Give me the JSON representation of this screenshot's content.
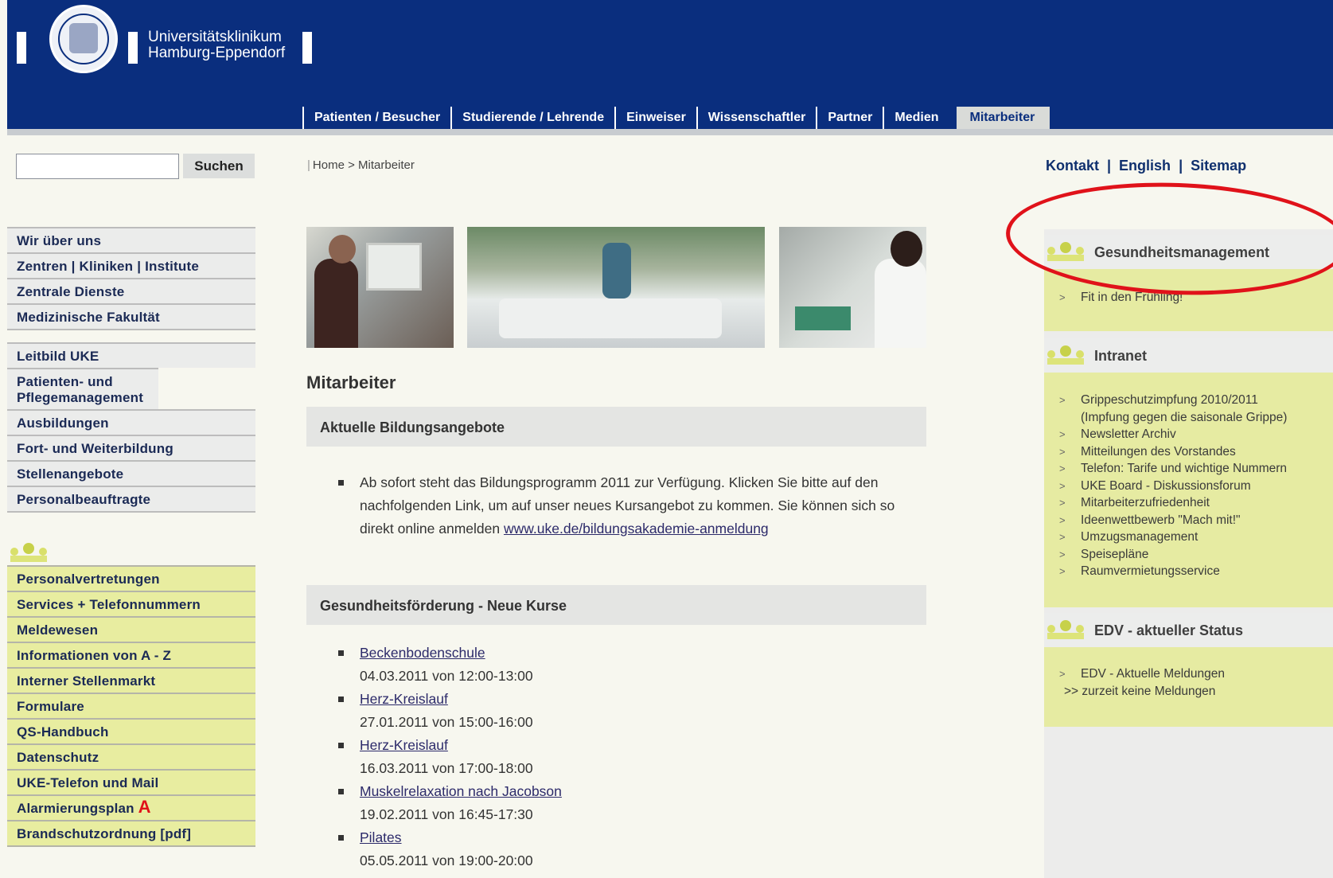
{
  "brand": {
    "line1": "Universitätsklinikum",
    "line2": "Hamburg-Eppendorf"
  },
  "topnav": [
    "Patienten / Besucher",
    "Studierende / Lehrende",
    "Einweiser",
    "Wissenschaftler",
    "Partner",
    "Medien",
    "Mitarbeiter"
  ],
  "search": {
    "placeholder": "",
    "button": "Suchen"
  },
  "breadcrumb": {
    "home": "Home",
    "sep": ">",
    "current": "Mitarbeiter",
    "bar": "|"
  },
  "util": {
    "kontakt": "Kontakt",
    "english": "English",
    "sitemap": "Sitemap",
    "bar": "|"
  },
  "leftnav": {
    "group1": [
      "Wir über uns",
      "Zentren |  Kliniken |  Institute",
      "Zentrale Dienste",
      "Medizinische Fakultät"
    ],
    "group2": [
      "Leitbild UKE",
      "Patienten- und Pflegemanagement",
      "Ausbildungen",
      "Fort- und Weiterbildung",
      "Stellenangebote",
      "Personalbeauftragte"
    ],
    "group3": [
      "Personalvertretungen",
      "Services + Telefonnummern",
      "Meldewesen",
      "Informationen von A - Z",
      "Interner Stellenmarkt",
      "Formulare",
      "QS-Handbuch",
      "Datenschutz",
      "UKE-Telefon und Mail",
      "Alarmierungsplan",
      "Brandschutzordnung [pdf]"
    ],
    "alarm_icon": "A"
  },
  "main": {
    "title": "Mitarbeiter",
    "section1": "Aktuelle Bildungsangebote",
    "bullet1_text": "Ab sofort steht das Bildungsprogramm 2011 zur Verfügung. Klicken Sie bitte auf den nachfolgenden Link, um auf unser neues Kursangebot zu kommen. Sie können sich so direkt online anmelden ",
    "bullet1_link": "www.uke.de/bildungsakademie-anmeldung",
    "section2": "Gesundheitsförderung - Neue Kurse",
    "courses": [
      {
        "name": "Beckenbodenschule",
        "date": "04.03.2011 von 12:00-13:00"
      },
      {
        "name": "Herz-Kreislauf",
        "date": "27.01.2011 von 15:00-16:00"
      },
      {
        "name": "Herz-Kreislauf",
        "date": "16.03.2011 von 17:00-18:00"
      },
      {
        "name": "Muskelrelaxation nach Jacobson",
        "date": "19.02.2011 von 16:45-17:30"
      },
      {
        "name": "Pilates",
        "date": "05.05.2011 von 19:00-20:00"
      }
    ]
  },
  "right": {
    "box1": {
      "title": "Gesundheitsmanagement",
      "items": [
        "Fit in den Frühling!"
      ]
    },
    "box2": {
      "title": "Intranet",
      "items": [
        "Grippeschutzimpfung 2010/2011",
        "(Impfung gegen die saisonale Grippe)",
        "Newsletter Archiv",
        "Mitteilungen des Vorstandes",
        "Telefon: Tarife und wichtige Nummern",
        "UKE Board - Diskussionsforum",
        "Mitarbeiterzufriedenheit",
        "Ideenwettbewerb \"Mach mit!\"",
        "Umzugsmanagement",
        "Speisepläne",
        "Raumvermietungsservice"
      ]
    },
    "box3": {
      "title": "EDV - aktueller Status",
      "items": [
        "EDV - Aktuelle Meldungen"
      ],
      "note": ">> zurzeit keine Meldungen"
    }
  },
  "colors": {
    "header": "#0a2e7e",
    "yellow": "#e6eba2",
    "highlight": "#e0121a"
  }
}
